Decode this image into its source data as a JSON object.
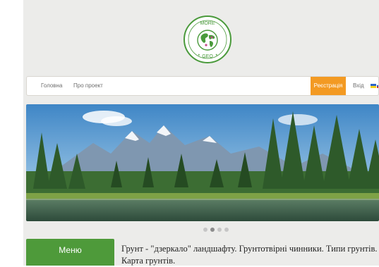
{
  "logo": {
    "top_text": "MORE",
    "bottom_text": "GEO",
    "ring_color": "#4a9a3b",
    "globe_color": "#4a9a3b"
  },
  "nav": {
    "items": [
      {
        "label": "Головна"
      },
      {
        "label": "Про проект"
      }
    ],
    "register_label": "Реєстрація",
    "login_label": "Вхід",
    "accent_color": "#f39a23"
  },
  "hero": {
    "description_icon": "mountain-lake-landscape"
  },
  "carousel": {
    "slide_count": 4,
    "active_index": 1
  },
  "sidebar": {
    "menu_label": "Меню",
    "menu_color": "#4e9a3a"
  },
  "article": {
    "title": "Грунт - \"дзеркало\" ландшафту. Грунтотвірні чинники. Типи грунтів. Карта грунтів."
  }
}
